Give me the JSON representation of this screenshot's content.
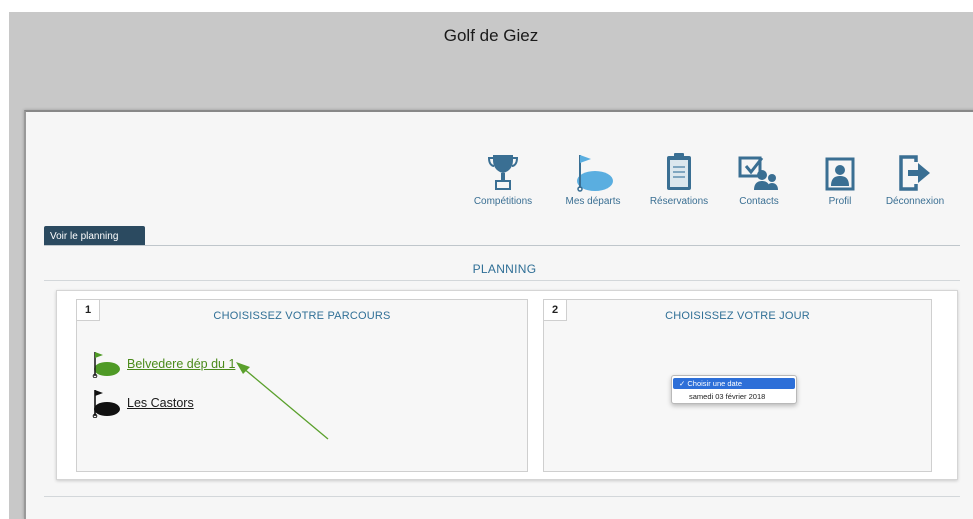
{
  "header": {
    "site_title": "Golf de Giez"
  },
  "nav": [
    {
      "label": "Compétitions",
      "icon": "trophy-icon"
    },
    {
      "label": "Mes départs",
      "icon": "golf-flag-icon"
    },
    {
      "label": "Réservations",
      "icon": "clipboard-icon"
    },
    {
      "label": "Contacts",
      "icon": "contacts-icon"
    },
    {
      "label": "Profil",
      "icon": "profile-icon"
    },
    {
      "label": "Déconnexion",
      "icon": "logout-icon"
    }
  ],
  "tab": {
    "label": "Voir le planning"
  },
  "planning": {
    "title": "PLANNING",
    "step1": {
      "number": "1",
      "title": "CHOISISSEZ VOTRE PARCOURS",
      "courses": [
        {
          "label": "Belvedere dép du 1",
          "color": "#4a8a1a"
        },
        {
          "label": "Les Castors",
          "color": "#1a1a1a"
        }
      ]
    },
    "step2": {
      "number": "2",
      "title": "CHOISISSEZ VOTRE JOUR",
      "date_options": [
        "✓ Choisir une date",
        "samedi 03 février 2018"
      ]
    }
  },
  "colors": {
    "accent": "#2f6f96",
    "tab_bg": "#2b4a60",
    "icon": "#3a6f93",
    "selected": "#2d6fd8",
    "arrow": "#5aa02c"
  }
}
